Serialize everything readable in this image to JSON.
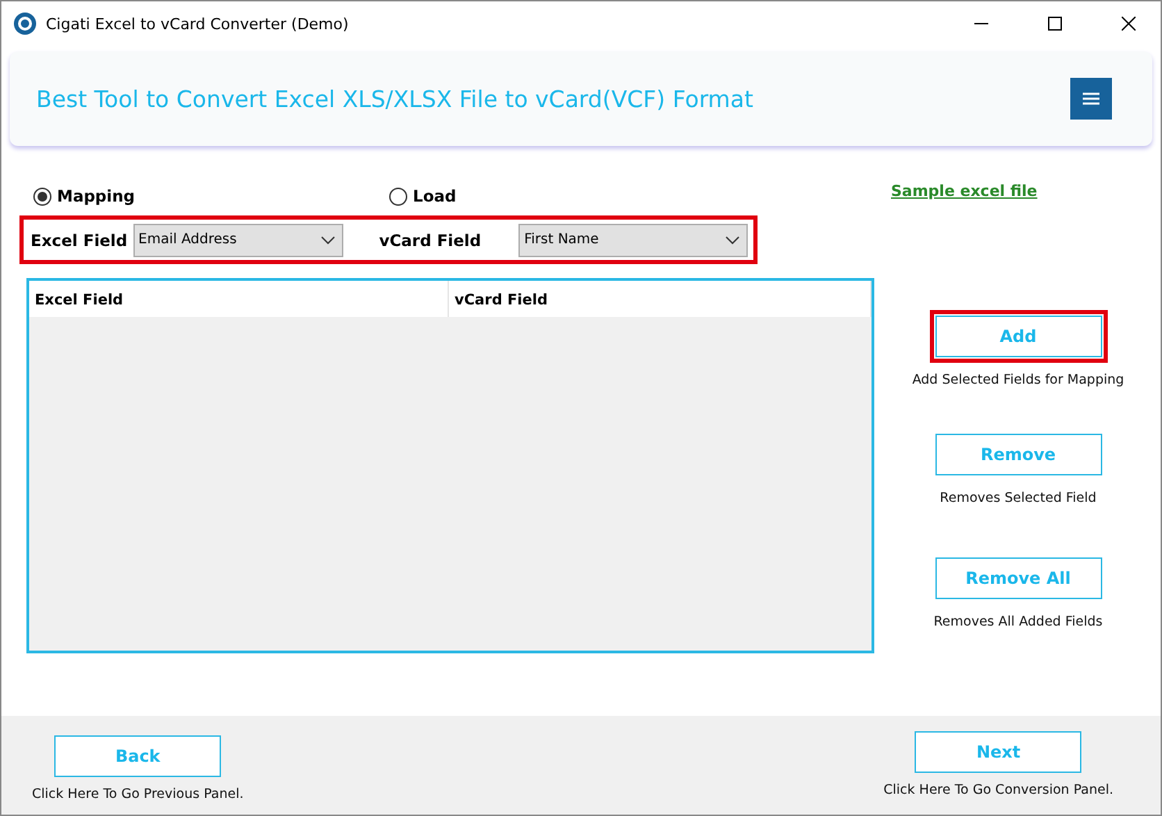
{
  "window": {
    "title": "Cigati Excel to vCard Converter (Demo)"
  },
  "header": {
    "title": "Best Tool to Convert Excel XLS/XLSX File to vCard(VCF) Format"
  },
  "modes": [
    {
      "label": "Mapping",
      "selected": true
    },
    {
      "label": "Load",
      "selected": false
    }
  ],
  "sample_link": "Sample excel file",
  "field_row": {
    "excel_label": "Excel Field",
    "excel_value": "Email Address",
    "vcard_label": "vCard Field",
    "vcard_value": "First Name"
  },
  "table": {
    "columns": [
      "Excel Field",
      "vCard Field"
    ]
  },
  "actions": [
    {
      "label": "Add",
      "hint": "Add Selected Fields for Mapping",
      "highlighted": true
    },
    {
      "label": "Remove",
      "hint": "Removes Selected Field",
      "highlighted": false
    },
    {
      "label": "Remove All",
      "hint": "Removes All Added Fields",
      "highlighted": false
    }
  ],
  "footer": {
    "back": {
      "label": "Back",
      "hint": "Click Here To Go Previous Panel."
    },
    "next": {
      "label": "Next",
      "hint": "Click Here To Go Conversion Panel."
    }
  }
}
